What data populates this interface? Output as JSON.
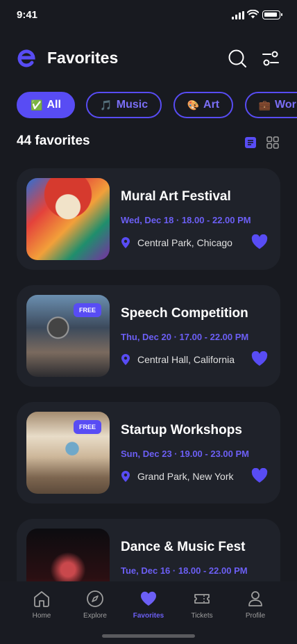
{
  "status": {
    "time": "9:41"
  },
  "header": {
    "title": "Favorites",
    "logo_letter": "e"
  },
  "filters": [
    {
      "emoji": "✅",
      "label": "All",
      "active": true
    },
    {
      "emoji": "🎵",
      "label": "Music",
      "active": false
    },
    {
      "emoji": "🎨",
      "label": "Art",
      "active": false
    },
    {
      "emoji": "💼",
      "label": "Workshops",
      "active": false
    }
  ],
  "count_label": "44 favorites",
  "events": [
    {
      "title": "Mural Art Festival",
      "date": "Wed, Dec 18 · 18.00 - 22.00 PM",
      "location": "Central Park, Chicago",
      "badge": ""
    },
    {
      "title": "Speech Competition",
      "date": "Thu, Dec 20 · 17.00 - 22.00 PM",
      "location": "Central Hall, California",
      "badge": "FREE"
    },
    {
      "title": "Startup Workshops",
      "date": "Sun, Dec 23 · 19.00 - 23.00 PM",
      "location": "Grand Park, New York",
      "badge": "FREE"
    },
    {
      "title": "Dance & Music Fest",
      "date": "Tue, Dec 16 · 18.00 - 22.00 PM",
      "location": "",
      "badge": ""
    }
  ],
  "nav": [
    {
      "label": "Home",
      "icon": "home-icon"
    },
    {
      "label": "Explore",
      "icon": "compass-icon"
    },
    {
      "label": "Favorites",
      "icon": "heart-icon",
      "active": true
    },
    {
      "label": "Tickets",
      "icon": "ticket-icon"
    },
    {
      "label": "Profile",
      "icon": "profile-icon"
    }
  ],
  "colors": {
    "accent": "#584cf4",
    "background": "#181a20",
    "card": "#1f222a"
  }
}
